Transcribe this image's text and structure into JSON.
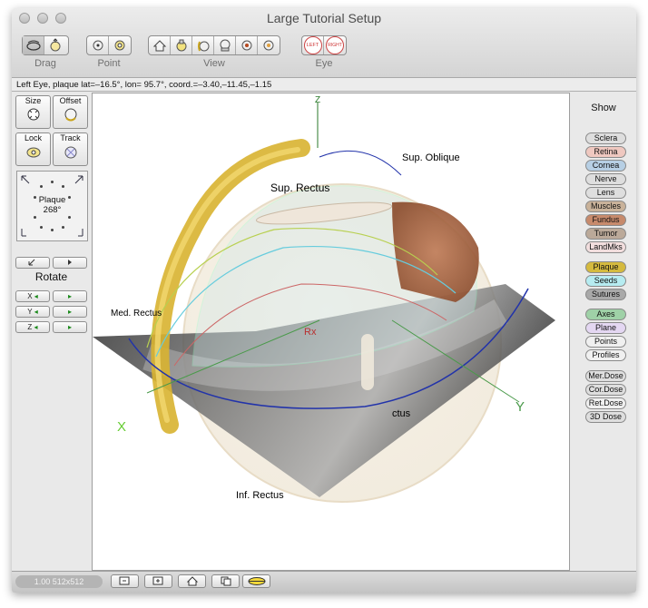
{
  "window": {
    "title": "Large Tutorial Setup"
  },
  "toolbar": {
    "drag_label": "Drag",
    "point_label": "Point",
    "view_label": "View",
    "eye_label": "Eye",
    "eye_left": "LEFT",
    "eye_right": "RIGHT",
    "drag_icons": [
      "rotate-eye-icon",
      "move-eye-icon"
    ],
    "point_icons": [
      "point-target-icon",
      "point-ring-icon"
    ],
    "view_icons": [
      "home-view-icon",
      "top-view-icon",
      "side-view-icon",
      "bottom-view-icon",
      "front-view-icon",
      "back-view-icon"
    ]
  },
  "status": {
    "text": "Left Eye, plaque lat=–16.5°, lon= 95.7°, coord.=–3.40,–11.45,–1.15"
  },
  "left_panel": {
    "size_label": "Size",
    "offset_label": "Offset",
    "lock_label": "Lock",
    "track_label": "Track",
    "plaque_label": "Plaque",
    "plaque_angle": "268°",
    "rotate_label": "Rotate",
    "axis_x": "X",
    "axis_y": "Y",
    "axis_z": "Z"
  },
  "viewport": {
    "labels": {
      "sup_oblique": "Sup. Oblique",
      "sup_rectus": "Sup. Rectus",
      "med_rectus": "Med. Rectus",
      "inf_rectus": "Inf. Rectus",
      "lat_rectus": "ctus",
      "rx": "Rx",
      "axis_x": "X",
      "axis_y": "Y",
      "axis_z": "Z"
    }
  },
  "right_panel": {
    "show_label": "Show",
    "buttons": [
      {
        "label": "Sclera",
        "color": "#dedede"
      },
      {
        "label": "Retina",
        "color": "#efc8c0"
      },
      {
        "label": "Cornea",
        "color": "#b7cfe4"
      },
      {
        "label": "Nerve",
        "color": "#dedede"
      },
      {
        "label": "Lens",
        "color": "#dedede"
      },
      {
        "label": "Muscles",
        "color": "#c9b29a"
      },
      {
        "label": "Fundus",
        "color": "#c78a6c"
      },
      {
        "label": "Tumor",
        "color": "#bba999"
      },
      {
        "label": "LandMks",
        "color": "#f2dede"
      },
      {
        "label": "Plaque",
        "color": "#d5ba3e"
      },
      {
        "label": "Seeds",
        "color": "#b6ecf1"
      },
      {
        "label": "Sutures",
        "color": "#a9a9a9"
      },
      {
        "label": "Axes",
        "color": "#9fd1a7"
      },
      {
        "label": "Plane",
        "color": "#e4d7f2"
      },
      {
        "label": "Points",
        "color": "#f0f0f0"
      },
      {
        "label": "Profiles",
        "color": "#f0f0f0"
      },
      {
        "label": "Mer.Dose",
        "color": "#dedede"
      },
      {
        "label": "Cor.Dose",
        "color": "#dedede"
      },
      {
        "label": "Ret.Dose",
        "color": "#f0f0f0"
      },
      {
        "label": "3D Dose",
        "color": "#dedede"
      }
    ]
  },
  "bottom": {
    "zoom_label": "1.00  512x512",
    "icons": [
      "zoom-out-icon",
      "zoom-in-icon",
      "home-icon",
      "copy-icon",
      "stereo-eye-icon"
    ]
  }
}
